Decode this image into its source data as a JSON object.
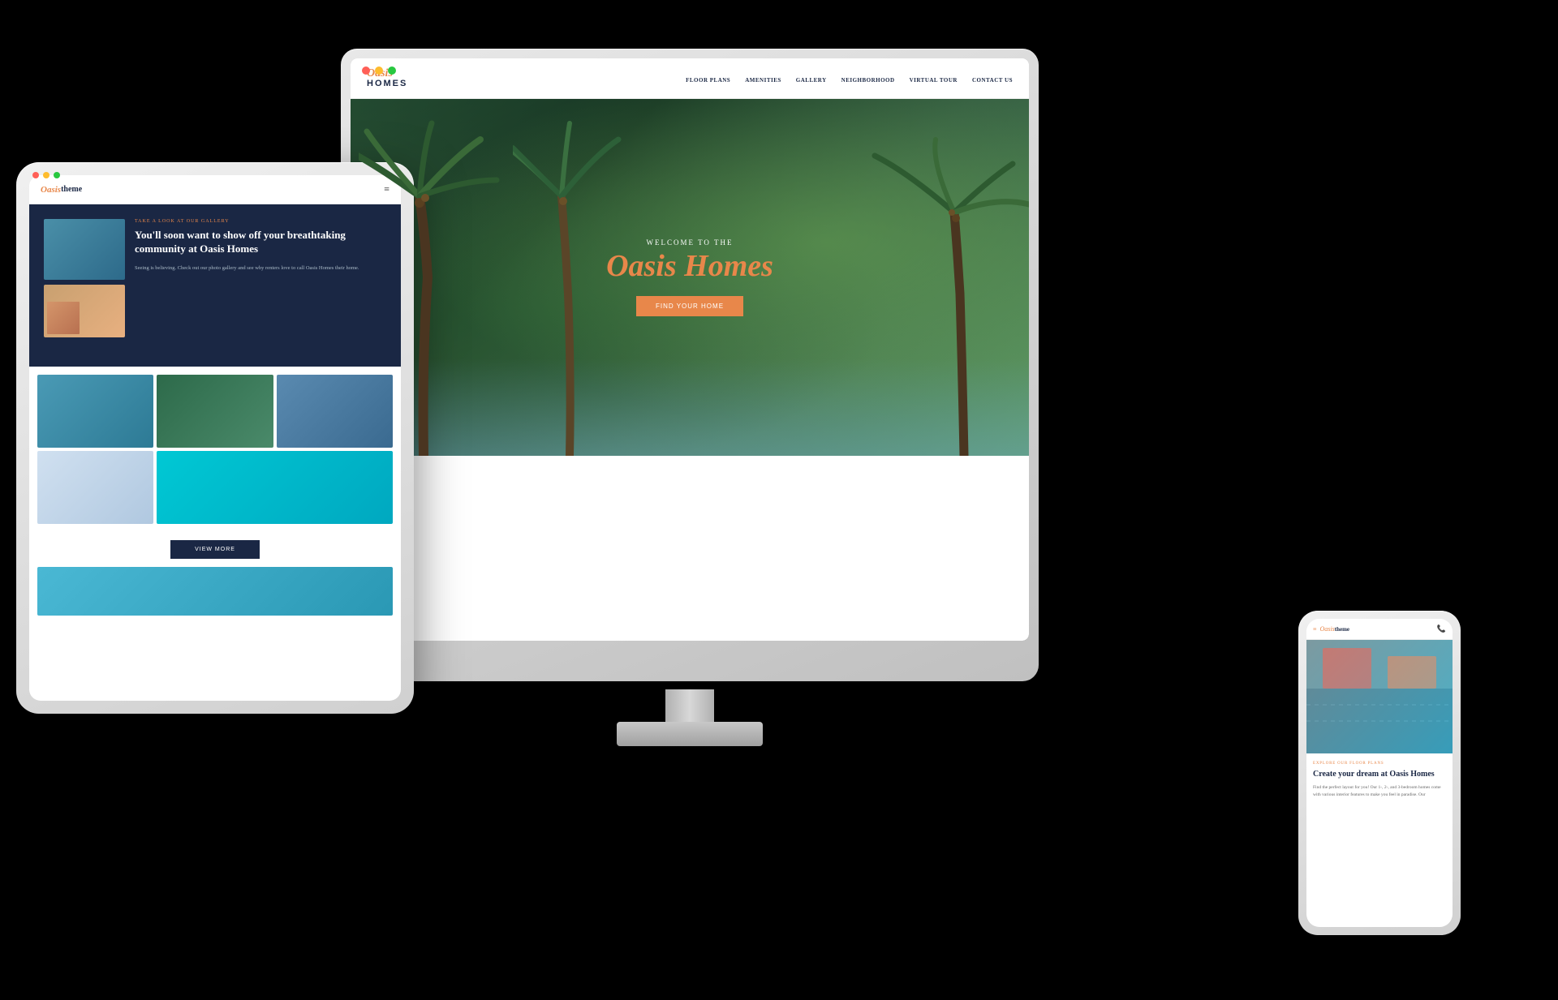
{
  "scene": {
    "background": "#000"
  },
  "desktop": {
    "nav": {
      "logo_oasis": "Oasis",
      "logo_homes": "HOMES",
      "links": [
        {
          "label": "FLOOR PLANS"
        },
        {
          "label": "AMENITIES"
        },
        {
          "label": "GALLERY"
        },
        {
          "label": "NEIGHBORHOOD"
        },
        {
          "label": "VIRTUAL TOUR"
        },
        {
          "label": "CONTACT US"
        }
      ]
    },
    "hero": {
      "welcome": "WELCOME TO THE",
      "title": "Oasis Homes",
      "button": "Find Your Home"
    }
  },
  "tablet": {
    "nav": {
      "logo_oasis": "Oasis",
      "logo_theme": "theme"
    },
    "hero": {
      "gallery_label": "TAKE A LOOK AT OUR GALLERY",
      "heading": "You'll soon want to show off your breathtaking community at Oasis Homes",
      "body": "Seeing is believing. Check out our photo gallery and see why renters love to call Oasis Homes their home."
    },
    "view_more": "VIEW MORE"
  },
  "phone": {
    "nav": {
      "logo_oasis": "Oasis",
      "logo_theme": "theme"
    },
    "content": {
      "section_label": "EXPLORE OUR FLOOR PLANS",
      "heading": "Create your dream at Oasis Homes",
      "body": "Find the perfect layout for you! Our 1-, 2-, and 3-bedroom homes come with various interior features to make you feel in paradise. Our"
    }
  },
  "dots": {
    "red": "#ff5f57",
    "yellow": "#febc2e",
    "green": "#28c840"
  }
}
